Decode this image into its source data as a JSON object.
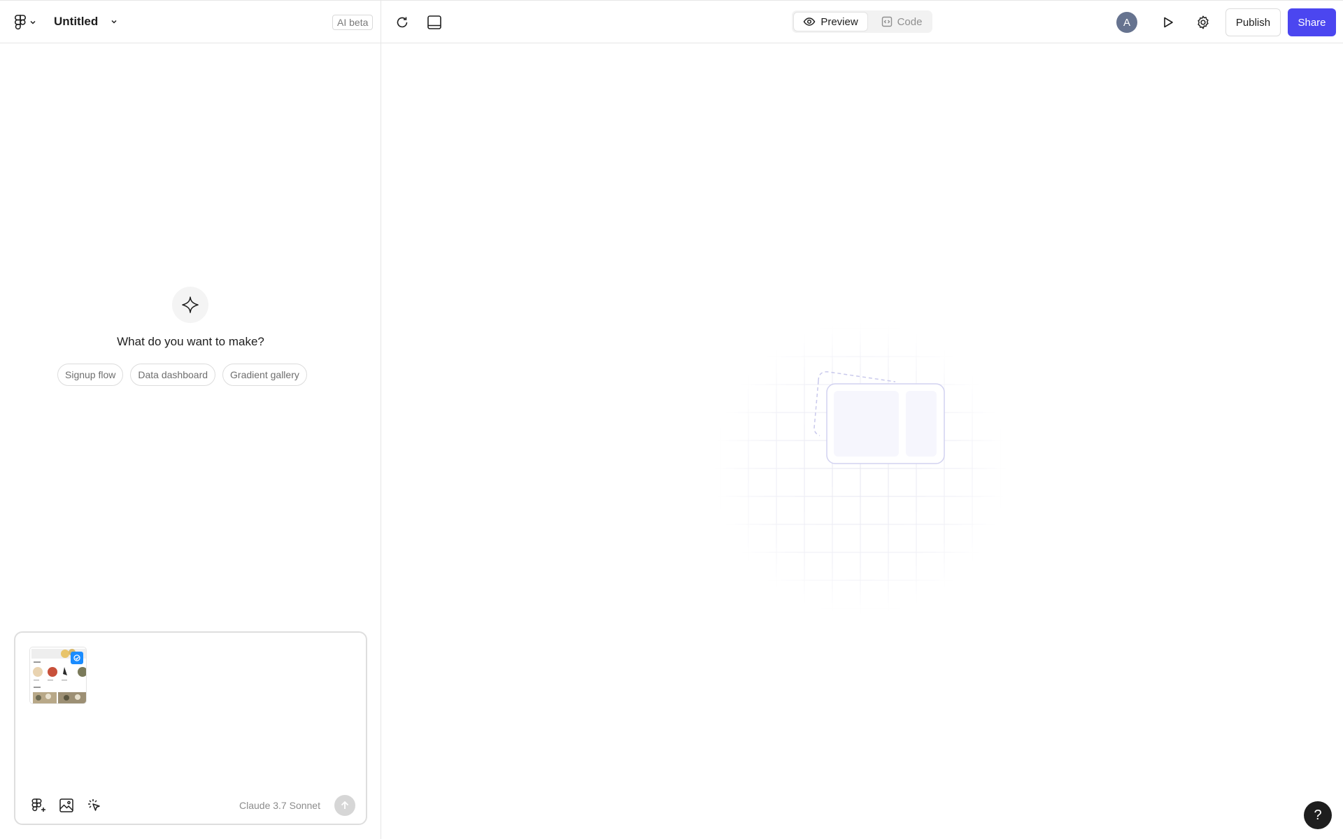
{
  "header": {
    "file_title": "Untitled",
    "ai_badge": "AI beta",
    "mode_preview": "Preview",
    "mode_code": "Code",
    "avatar_initial": "A",
    "publish_label": "Publish",
    "share_label": "Share",
    "icons": [
      "figma-logo-icon",
      "chevron-down-icon",
      "refresh-icon",
      "device-frame-icon",
      "eye-icon",
      "code-icon",
      "play-icon",
      "gear-icon"
    ]
  },
  "left_panel": {
    "prompt_title": "What do you want to make?",
    "suggestions": [
      "Signup flow",
      "Data dashboard",
      "Gradient gallery"
    ],
    "composer": {
      "model_label": "Claude 3.7 Sonnet",
      "tools": [
        "figma-add-icon",
        "image-icon",
        "sparkle-cursor-icon"
      ]
    }
  },
  "canvas": {
    "help_label": "?"
  },
  "colors": {
    "accent": "#4b46f0",
    "avatar": "#66738f",
    "border": "#e6e6e6",
    "attachment_badge": "#1a8cff"
  }
}
